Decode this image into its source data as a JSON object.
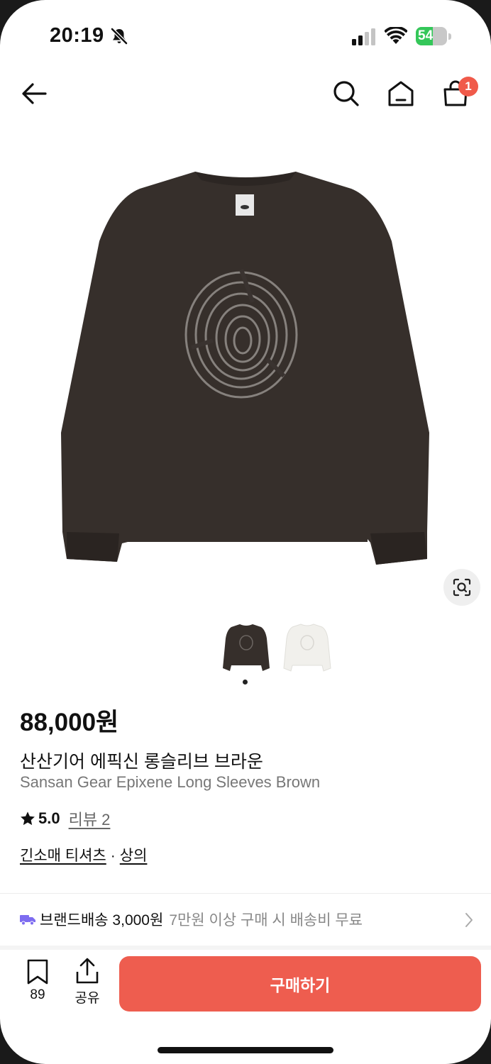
{
  "status_bar": {
    "time": "20:19",
    "battery": "54",
    "battery_level": 0.54,
    "battery_color": "#34c759",
    "icons": [
      "bell-slash-icon",
      "signal-icon",
      "wifi-icon",
      "battery-charging-icon"
    ]
  },
  "nav": {
    "icons": [
      "back-arrow-icon",
      "search-icon",
      "home-icon",
      "shopping-bag-icon"
    ],
    "cart_badge": "1"
  },
  "gallery": {
    "thumbnails": [
      "brown",
      "white"
    ],
    "active_index": 0,
    "lens_icon": "image-search-icon"
  },
  "product": {
    "price": "88,000원",
    "name_ko": "산산기어 에픽신 롱슬리브 브라운",
    "name_en": "Sansan Gear Epixene Long Sleeves Brown",
    "rating": "5.0",
    "review_label": "리뷰 2",
    "category": "긴소매 티셔츠",
    "category_sep": "·",
    "parent_category": "상의"
  },
  "shipping": {
    "label": "브랜드배송 3,000원",
    "note": "7만원 이상 구매 시 배송비 무료"
  },
  "bottom_bar": {
    "bookmark_count": "89",
    "share_label": "공유",
    "buy_label": "구매하기",
    "buy_color": "#ee5d4f"
  }
}
